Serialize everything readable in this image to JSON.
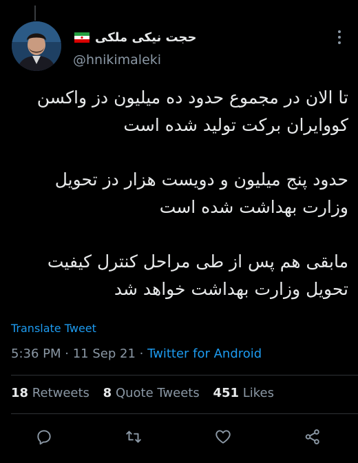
{
  "author": {
    "display_name": "حجت نیکی ملکی",
    "handle": "@hnikimaleki",
    "flag_icon": "iran-flag-icon"
  },
  "tweet": {
    "paragraphs": [
      "تا الان در مجموع حدود ده میلیون دز واکسن کووایران برکت تولید شده است",
      "حدود پنج میلیون و دویست هزار دز تحویل وزارت بهداشت شده است",
      "مابقی هم پس از طی مراحل کنترل کیفیت تحویل وزارت بهداشت خواهد شد"
    ],
    "translate_label": "Translate Tweet",
    "time": "5:36 PM",
    "date": "11 Sep 21",
    "source": "Twitter for Android"
  },
  "stats": {
    "retweets_count": "18",
    "retweets_label": "Retweets",
    "quotes_count": "8",
    "quotes_label": "Quote Tweets",
    "likes_count": "451",
    "likes_label": "Likes"
  },
  "actions": [
    "reply-icon",
    "retweet-icon",
    "like-icon",
    "share-icon"
  ],
  "colors": {
    "background": "#000000",
    "text_primary": "#e7e9ea",
    "text_secondary": "#8b98a5",
    "accent": "#1d9bf0",
    "divider": "#2f3336"
  }
}
